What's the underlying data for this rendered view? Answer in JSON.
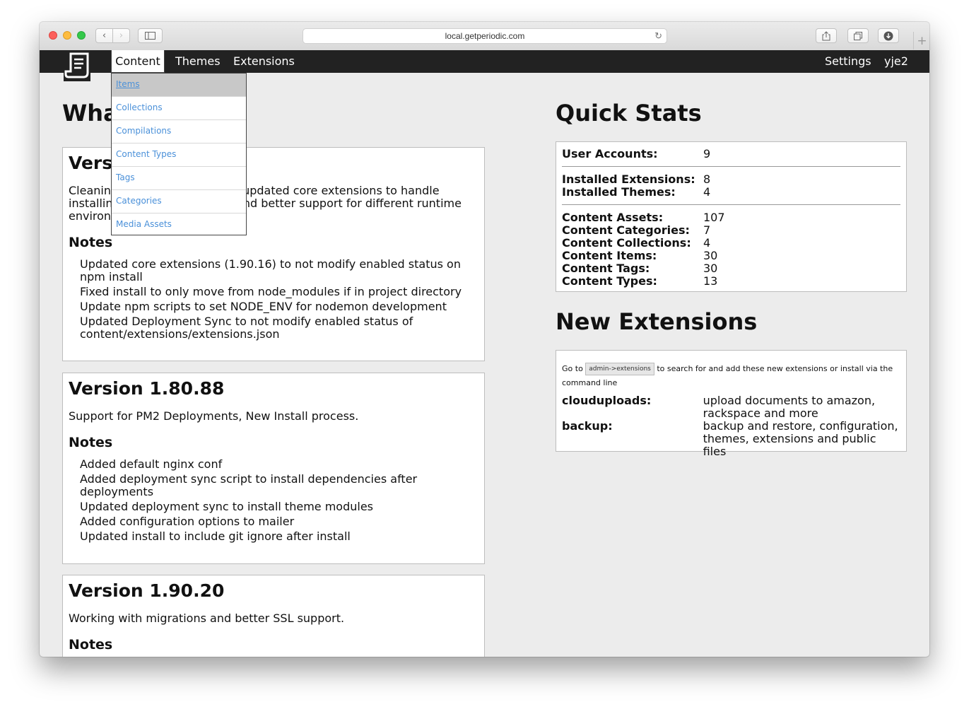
{
  "browser": {
    "url": "local.getperiodic.com"
  },
  "nav": {
    "items": [
      "Content",
      "Themes",
      "Extensions"
    ],
    "right": [
      "Settings",
      "yje2"
    ]
  },
  "dropdown": {
    "items": [
      "Items",
      "Collections",
      "Compilations",
      "Content Types",
      "Tags",
      "Categories",
      "Media Assets"
    ]
  },
  "whats_new": {
    "title": "What's New",
    "versions": [
      {
        "title": "Version 1.90.12",
        "desc": "Cleaning up the periodic core, updated core extensions to handle installing existing extensions and better support for different runtime environments",
        "notes_label": "Notes",
        "notes": [
          "Updated core extensions (1.90.16) to not modify enabled status on npm install",
          "Fixed install to only move from node_modules if in project directory",
          "Update npm scripts to set NODE_ENV for nodemon development",
          "Updated Deployment Sync to not modify enabled status of content/extensions/extensions.json"
        ]
      },
      {
        "title": "Version 1.80.88",
        "desc": "Support for PM2 Deployments, New Install process.",
        "notes_label": "Notes",
        "notes": [
          "Added default nginx conf",
          "Added deployment sync script to install dependencies after deployments",
          "Updated deployment sync to install theme modules",
          "Added configuration options to mailer",
          "Updated install to include git ignore after install"
        ]
      },
      {
        "title": "Version 1.90.20",
        "desc": "Working with migrations and better SSL support.",
        "notes_label": "Notes",
        "notes": []
      }
    ]
  },
  "quick_stats": {
    "title": "Quick Stats",
    "groups": [
      [
        {
          "label": "User Accounts:",
          "value": "9"
        }
      ],
      [
        {
          "label": "Installed Extensions:",
          "value": "8"
        },
        {
          "label": "Installed Themes:",
          "value": "4"
        }
      ],
      [
        {
          "label": "Content Assets:",
          "value": "107"
        },
        {
          "label": "Content Categories:",
          "value": "7"
        },
        {
          "label": "Content Collections:",
          "value": "4"
        },
        {
          "label": "Content Items:",
          "value": "30"
        },
        {
          "label": "Content Tags:",
          "value": "30"
        },
        {
          "label": "Content Types:",
          "value": "13"
        }
      ]
    ]
  },
  "new_extensions": {
    "title": "New Extensions",
    "intro_prefix": "Go to",
    "intro_code": "admin->extensions",
    "intro_suffix": "to search for and add these new extensions or install via the command line",
    "items": [
      {
        "name": "clouduploads:",
        "desc": "upload documents to amazon, rackspace and more"
      },
      {
        "name": "backup:",
        "desc": "backup and restore, configuration, themes, extensions and public files"
      }
    ]
  }
}
